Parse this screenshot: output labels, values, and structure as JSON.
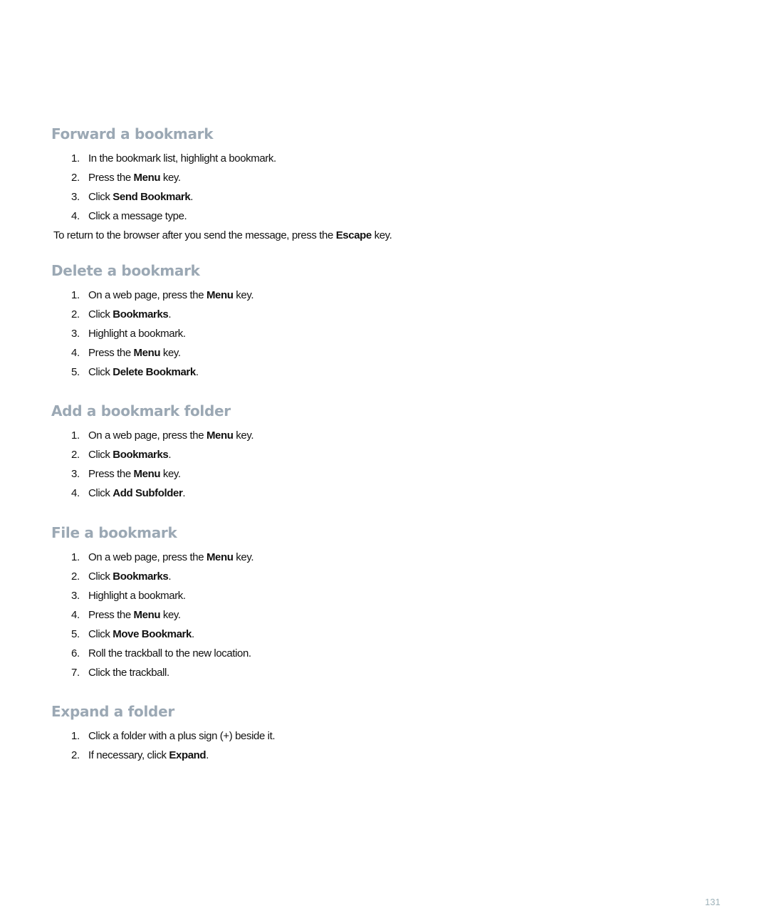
{
  "sections": [
    {
      "title": "Forward a bookmark",
      "steps": [
        {
          "num": "1.",
          "before": "In the bookmark list, highlight a bookmark.",
          "bold": "",
          "after": ""
        },
        {
          "num": "2.",
          "before": "Press the ",
          "bold": "Menu",
          "after": " key."
        },
        {
          "num": "3.",
          "before": "Click ",
          "bold": "Send Bookmark",
          "after": "."
        },
        {
          "num": "4.",
          "before": "Click a message type.",
          "bold": "",
          "after": ""
        }
      ],
      "note": {
        "before": "To return to the browser after you send the message, press the ",
        "bold": "Escape",
        "after": " key."
      }
    },
    {
      "title": "Delete a bookmark",
      "steps": [
        {
          "num": "1.",
          "before": "On a web page, press the ",
          "bold": "Menu",
          "after": " key."
        },
        {
          "num": "2.",
          "before": "Click ",
          "bold": "Bookmarks",
          "after": "."
        },
        {
          "num": "3.",
          "before": "Highlight a bookmark.",
          "bold": "",
          "after": ""
        },
        {
          "num": "4.",
          "before": "Press the ",
          "bold": "Menu",
          "after": " key."
        },
        {
          "num": "5.",
          "before": "Click ",
          "bold": "Delete Bookmark",
          "after": "."
        }
      ]
    },
    {
      "title": "Add a bookmark folder",
      "steps": [
        {
          "num": "1.",
          "before": "On a web page, press the ",
          "bold": "Menu",
          "after": " key."
        },
        {
          "num": "2.",
          "before": "Click ",
          "bold": "Bookmarks",
          "after": "."
        },
        {
          "num": "3.",
          "before": "Press the ",
          "bold": "Menu",
          "after": " key."
        },
        {
          "num": "4.",
          "before": "Click ",
          "bold": "Add Subfolder",
          "after": "."
        }
      ]
    },
    {
      "title": "File a bookmark",
      "steps": [
        {
          "num": "1.",
          "before": "On a web page, press the ",
          "bold": "Menu",
          "after": " key."
        },
        {
          "num": "2.",
          "before": "Click ",
          "bold": "Bookmarks",
          "after": "."
        },
        {
          "num": "3.",
          "before": "Highlight a bookmark.",
          "bold": "",
          "after": ""
        },
        {
          "num": "4.",
          "before": "Press the ",
          "bold": "Menu",
          "after": " key."
        },
        {
          "num": "5.",
          "before": "Click ",
          "bold": "Move Bookmark",
          "after": "."
        },
        {
          "num": "6.",
          "before": "Roll the trackball to the new location.",
          "bold": "",
          "after": ""
        },
        {
          "num": "7.",
          "before": "Click the trackball.",
          "bold": "",
          "after": ""
        }
      ]
    },
    {
      "title": "Expand a folder",
      "steps": [
        {
          "num": "1.",
          "before": "Click a folder with a plus sign (+) beside it.",
          "bold": "",
          "after": ""
        },
        {
          "num": "2.",
          "before": "If necessary, click ",
          "bold": "Expand",
          "after": "."
        }
      ]
    }
  ],
  "page_number": "131",
  "colors": {
    "heading": "#9ba8b4",
    "body_text": "#111111",
    "page_number": "#9fb3ba"
  }
}
